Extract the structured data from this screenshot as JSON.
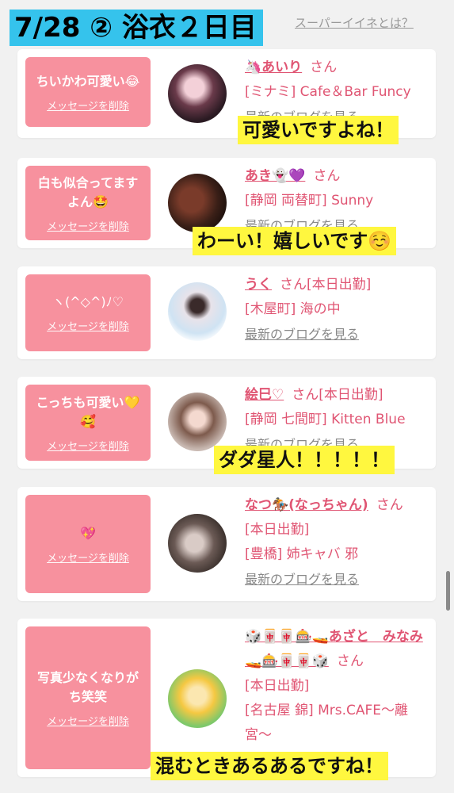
{
  "title_banner": "7/28 ② 浴衣２日目",
  "top_link": "スーパーイイネとは？",
  "delete_label": "メッセージを削除",
  "blog_label": "最新のブログを見る",
  "san": "さん",
  "cards": [
    {
      "message": "ちいかわ可愛い😂",
      "name": "🦄あいり",
      "status": "",
      "area": "[ミナミ] Cafe＆Bar Funcy",
      "caption": "可愛いですよね！"
    },
    {
      "message": "白も似合ってますよん🤩",
      "name": "あき👻💜",
      "status": "",
      "area": "[静岡 両替町] Sunny",
      "caption": "わーい！嬉しいです☺️"
    },
    {
      "message": "ヽ(^◇^)ﾉ♡",
      "name": "うく",
      "status": "[本日出勤]",
      "area": "[木屋町] 海の中",
      "caption": ""
    },
    {
      "message": "こっちも可愛い💛🥰",
      "name": "絵巳♡",
      "status": "[本日出勤]",
      "area": "[静岡 七間町] Kitten Blue",
      "caption": "ダダ星人！！！！！"
    },
    {
      "message": "💖",
      "name": "なつ🏇(なっちゃん)",
      "status": "[本日出勤]",
      "area": "[豊橋] 姉キャバ 邪",
      "caption": ""
    },
    {
      "message": "写真少なくなりがち笑笑",
      "name": "🎲🀄🀄🎰🚤あざと　みなみ🚤🎰🀄🀄🎲",
      "status": "[本日出勤]",
      "area": "[名古屋 錦] Mrs.CAFE〜離宮〜",
      "caption": "混むときあるあるですね！"
    }
  ],
  "colors": {
    "banner_bg": "#35c3ec",
    "message_bg": "#f7919e",
    "name_pink": "#e05573",
    "caption_bg": "#fff73f"
  }
}
